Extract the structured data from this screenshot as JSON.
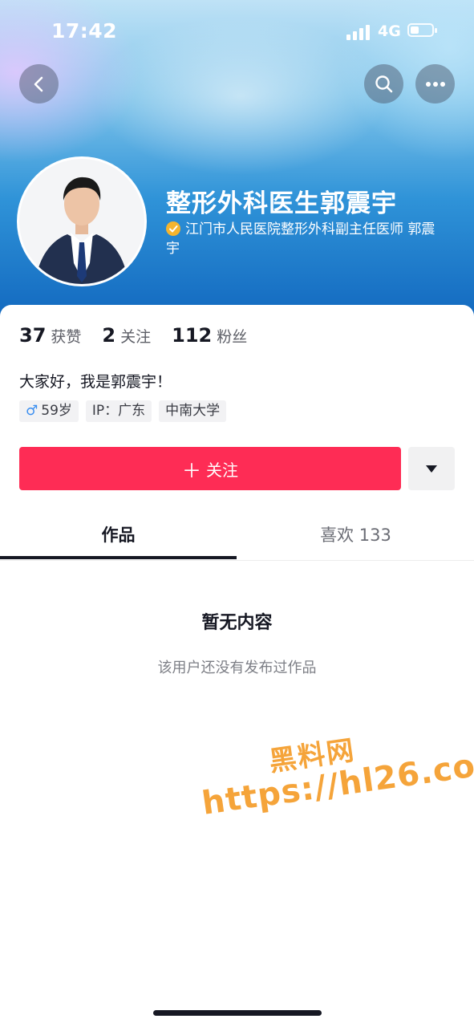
{
  "status_bar": {
    "time": "17:42",
    "network": "4G",
    "battery_percent": 30
  },
  "nav": {
    "back_icon": "chevron-left-icon",
    "search_icon": "search-icon",
    "more_icon": "more-horizontal-icon"
  },
  "profile": {
    "nickname": "整形外科医生郭震宇",
    "verification": "江门市人民医院整形外科副主任医师 郭震宇",
    "verification_icon": "verified-check-icon",
    "verify_color": "#f4b42e"
  },
  "stats": [
    {
      "value": "37",
      "label": "获赞"
    },
    {
      "value": "2",
      "label": "关注"
    },
    {
      "value": "112",
      "label": "粉丝"
    }
  ],
  "bio": "大家好，我是郭震宇！",
  "tags": [
    {
      "icon": "male-icon",
      "text": "59岁"
    },
    {
      "text": "IP：广东"
    },
    {
      "text": "中南大学"
    }
  ],
  "actions": {
    "follow_label": "关注",
    "follow_color": "#fe2c55",
    "dropdown_icon": "triangle-down-icon"
  },
  "tabs": [
    {
      "label": "作品",
      "active": true
    },
    {
      "label": "喜欢 133",
      "active": false
    }
  ],
  "empty": {
    "title": "暂无内容",
    "subtitle": "该用户还没有发布过作品"
  },
  "watermark": {
    "line1": "黑料网",
    "line2": "https://hl26.co",
    "color": "#f5a43a"
  }
}
